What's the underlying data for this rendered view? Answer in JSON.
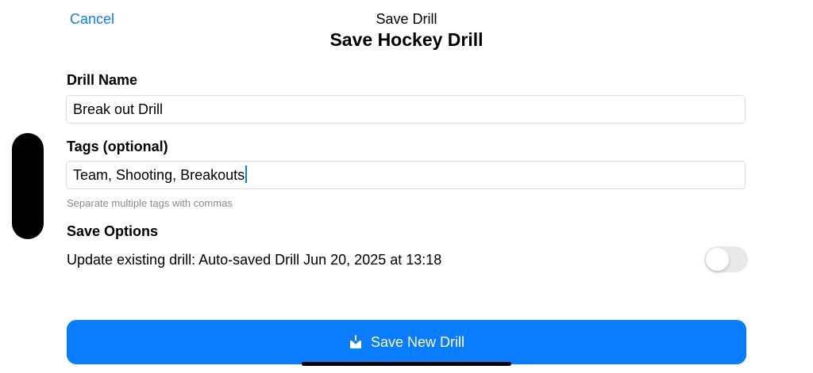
{
  "nav": {
    "cancel_label": "Cancel",
    "title": "Save Drill",
    "subtitle": "Save Hockey Drill"
  },
  "form": {
    "drill_name_label": "Drill Name",
    "drill_name_value": "Break out Drill",
    "tags_label": "Tags (optional)",
    "tags_value": "Team, Shooting, Breakouts",
    "tags_hint": "Separate multiple tags with commas"
  },
  "options": {
    "section_label": "Save Options",
    "update_existing_label": "Update existing drill: Auto-saved Drill Jun 20, 2025 at 13:18",
    "update_existing_on": false
  },
  "actions": {
    "save_label": "Save New Drill",
    "save_icon": "tray-arrow-down-icon"
  },
  "colors": {
    "accent": "#0a7cff",
    "toggle_off": "#e9e9eb",
    "hint": "#8a8a8e"
  }
}
